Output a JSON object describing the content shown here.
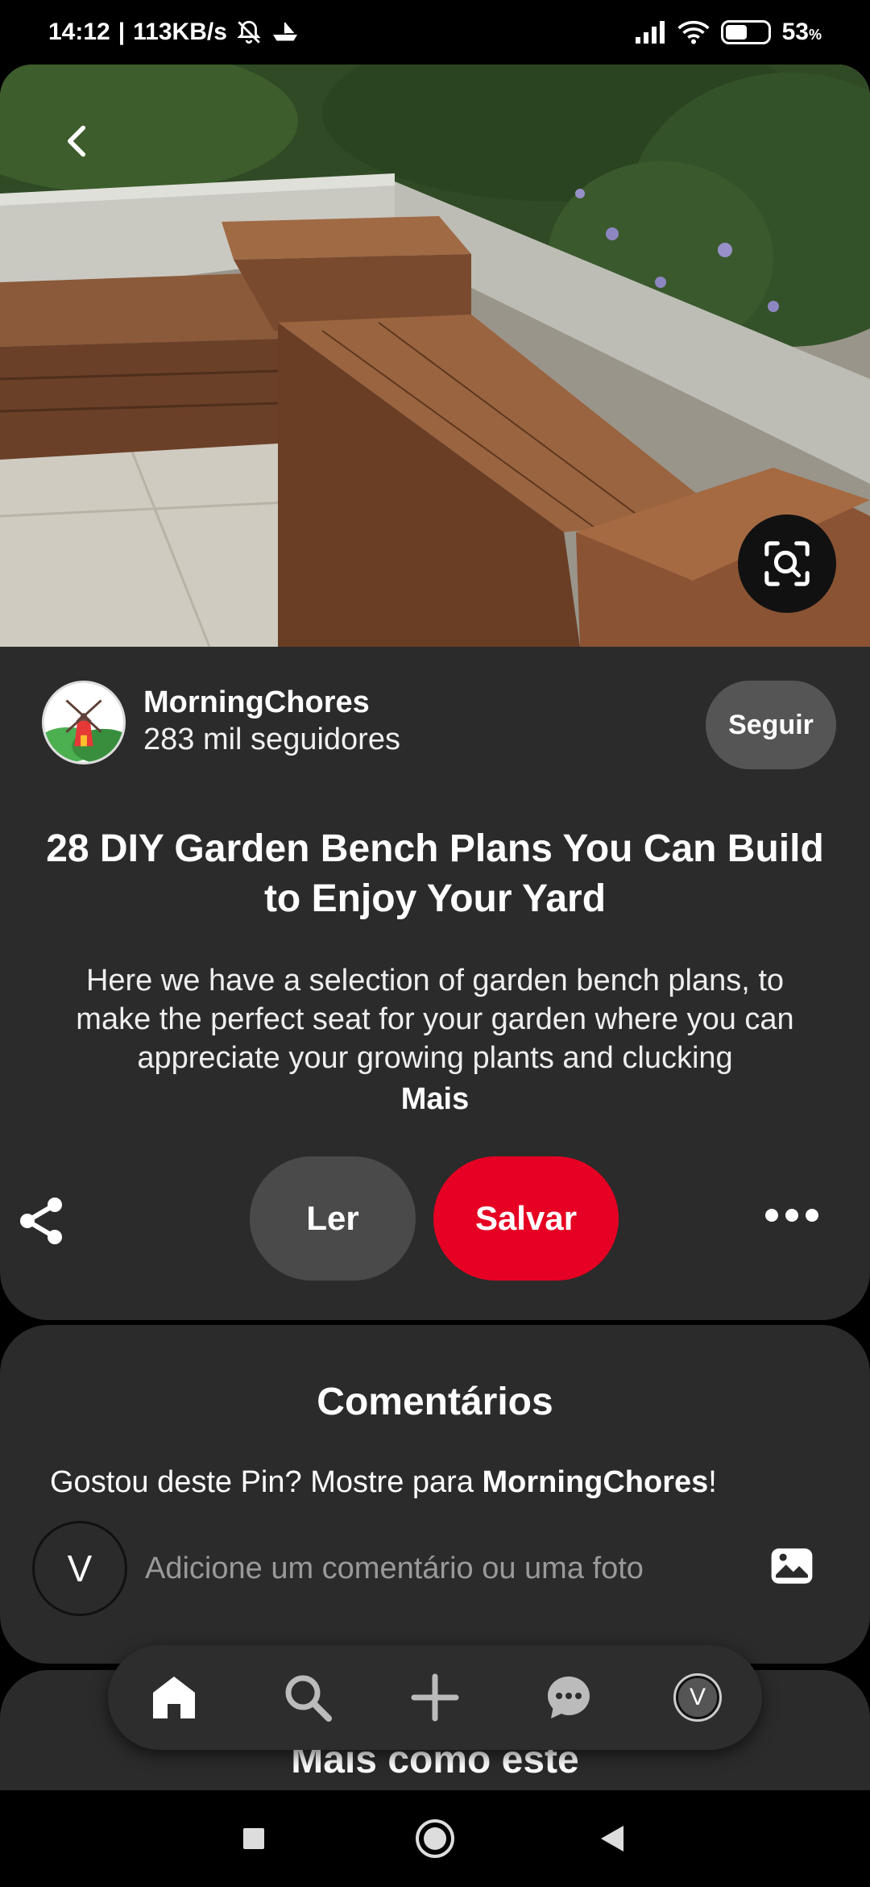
{
  "status_bar": {
    "time": "14:12",
    "speed": "113KB/s",
    "battery": "53",
    "battery_unit": "%",
    "battery_level": 0.53
  },
  "hero": {
    "image_alt": "Garden bench photo"
  },
  "creator": {
    "name": "MorningChores",
    "followers": "283 mil seguidores",
    "follow_label": "Seguir"
  },
  "pin": {
    "title": "28 DIY Garden Bench Plans You Can Build to Enjoy Your Yard",
    "description": "Here we have a selection of garden bench plans, to make the perfect seat for your garden where you can appreciate your growing plants and clucking",
    "more_label": "Mais"
  },
  "actions": {
    "read_label": "Ler",
    "save_label": "Salvar"
  },
  "comments": {
    "title": "Comentários",
    "prompt_prefix": "Gostou deste Pin? Mostre para ",
    "prompt_creator": "MorningChores",
    "prompt_suffix": "!",
    "user_initial": "V",
    "input_placeholder": "Adicione um comentário ou uma foto"
  },
  "more_like_this": {
    "title": "Mais como este"
  },
  "bottom_nav": {
    "profile_initial": "V",
    "icons": [
      "home-icon",
      "search-icon",
      "plus-icon",
      "chat-icon",
      "profile-avatar"
    ]
  },
  "colors": {
    "accent": "#e60023",
    "card": "#2b2b2b",
    "background": "#000000"
  }
}
